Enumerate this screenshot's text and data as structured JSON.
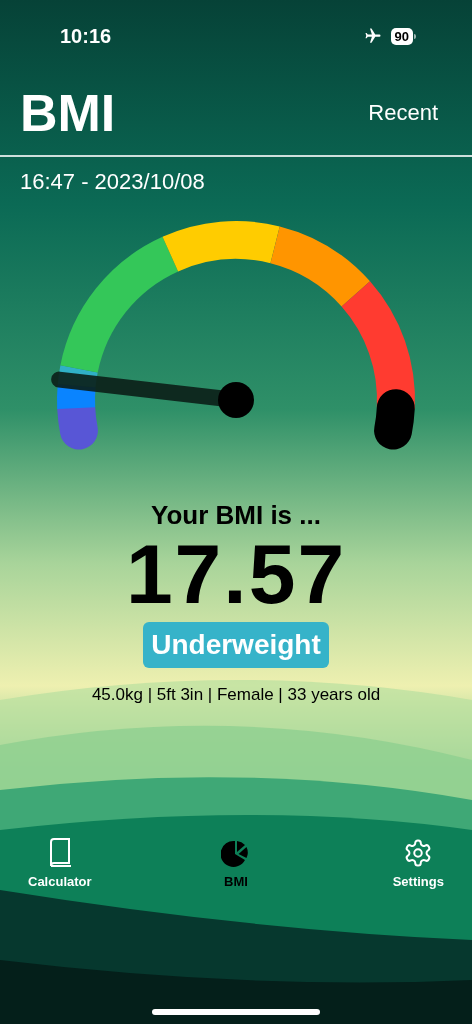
{
  "status_bar": {
    "time": "10:16",
    "battery": "90",
    "airplane_mode": true
  },
  "header": {
    "title": "BMI",
    "action": "Recent"
  },
  "date": "16:47 - 2023/10/08",
  "result": {
    "heading": "Your BMI is ...",
    "value": "17.57",
    "category": "Underweight",
    "details": "45.0kg | 5ft 3in | Female | 33 years old"
  },
  "tabs": [
    {
      "label": "Calculator",
      "kind": "book",
      "selected": false
    },
    {
      "label": "BMI",
      "kind": "pie",
      "selected": true
    },
    {
      "label": "Settings",
      "kind": "gear",
      "selected": false
    }
  ]
}
